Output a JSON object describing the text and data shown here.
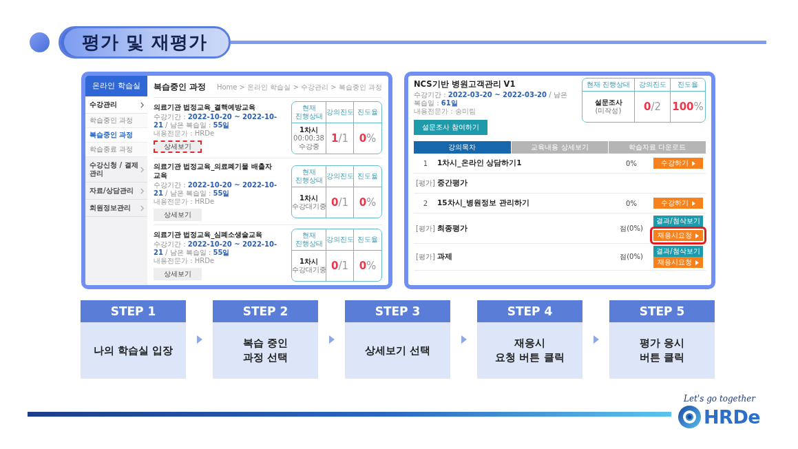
{
  "header": {
    "title": "평가 및 재평가"
  },
  "left_screen": {
    "sidebar": {
      "title": "온라인 학습실",
      "items": [
        {
          "label": "수강관리",
          "expanded": true,
          "children": [
            {
              "label": "학습중인 과정",
              "selected": false
            },
            {
              "label": "복습중인 과정",
              "selected": true
            },
            {
              "label": "학습종료 과정",
              "selected": false
            }
          ]
        },
        {
          "label": "수강신청 / 결제 관리",
          "expanded": false
        },
        {
          "label": "자료/상담관리",
          "expanded": false
        },
        {
          "label": "회원정보관리",
          "expanded": false
        }
      ]
    },
    "page_title": "복습중인 과정",
    "breadcrumb": "Home > 온라인 학습실 > 수강관리 > 복습중인 과정",
    "courses": [
      {
        "title": "의료기관 법정교육_결핵예방교육",
        "period": "수강기간 : **2022-10-20 ~ 2022-10-21** / 남은 복습일 : **55일**",
        "expert": "내용전문가 : HRDe",
        "button": {
          "label": "상세보기",
          "highlighted": true
        },
        "status_table": {
          "columns": [
            "현재 진행상태",
            "강의진도",
            "진도율"
          ],
          "status": [
            "1차시",
            "00:00:38",
            "수강중"
          ],
          "progress": "**1**/1",
          "rate": "**0**%"
        }
      },
      {
        "title": "의료기관 법정교육_의료폐기물 배출자 교육",
        "period": "수강기간 : **2022-10-20 ~ 2022-10-21** / 남은 복습일 : **55일**",
        "expert": "내용전문가 : HRDe",
        "button": {
          "label": "상세보기",
          "highlighted": false
        },
        "status_table": {
          "columns": [
            "현재 진행상태",
            "강의진도",
            "진도율"
          ],
          "status": [
            "1차시",
            "수강대기중"
          ],
          "progress": "**0**/1",
          "rate": "**0**%"
        }
      },
      {
        "title": "의료기관 법정교육_심폐소생술교육",
        "period": "수강기간 : **2022-10-20 ~ 2022-10-21** / 남은 복습일 : **55일**",
        "expert": "내용전문가 : HRDe",
        "button": {
          "label": "상세보기",
          "highlighted": false
        },
        "status_table": {
          "columns": [
            "현재 진행상태",
            "강의진도",
            "진도율"
          ],
          "status": [
            "1차시",
            "수강대기중"
          ],
          "progress": "**0**/1",
          "rate": "**0**%"
        }
      }
    ]
  },
  "right_screen": {
    "course_title": "NCS기반 병원고객관리 V1",
    "period": "수강기간 : **2022-03-20 ~ 2022-03-20** / 남은 복습일 : **61일**",
    "expert": "내용전문가 : 송미림",
    "survey_button": "설문조사 참여하기",
    "status_table": {
      "columns": [
        "현재 진행상태",
        "강의진도",
        "진도율"
      ],
      "status": [
        "설문조사",
        "(미작성)"
      ],
      "progress": "**0**/2",
      "rate": "**100**%"
    },
    "tabs": [
      {
        "label": "강의목차",
        "selected": true
      },
      {
        "label": "교육내용 상세보기",
        "selected": false
      },
      {
        "label": "학습자료 다운로드",
        "selected": false
      }
    ],
    "lessons": [
      {
        "kind": "lesson",
        "number": "1",
        "title": "1차시_온라인 상담하기1",
        "score": "0%",
        "buttons": [
          {
            "kind": "action",
            "label": "수강하기",
            "highlighted": false
          }
        ]
      },
      {
        "kind": "exam",
        "tag": "[평가]",
        "title": "중간평가"
      },
      {
        "kind": "lesson",
        "number": "2",
        "title": "15차시_병원정보 관리하기",
        "score": "0%",
        "buttons": [
          {
            "kind": "action",
            "label": "수강하기",
            "highlighted": false
          }
        ]
      },
      {
        "kind": "exam",
        "tag": "[평가]",
        "title": "최종평가",
        "score": "점(0%)",
        "buttons": [
          {
            "kind": "review",
            "label": "결과/첨삭보기",
            "highlighted": false
          },
          {
            "kind": "action",
            "label": "재응시요청",
            "highlighted": true
          }
        ]
      },
      {
        "kind": "exam",
        "tag": "[평가]",
        "title": "과제",
        "score": "점(0%)",
        "buttons": [
          {
            "kind": "review",
            "label": "결과/첨삭보기",
            "highlighted": false
          },
          {
            "kind": "action",
            "label": "재응시요청",
            "highlighted": false
          }
        ]
      }
    ]
  },
  "steps": [
    {
      "label": "STEP 1",
      "text": "나의 학습실 입장"
    },
    {
      "label": "STEP 2",
      "text": "복습 중인\n과정 선택"
    },
    {
      "label": "STEP 3",
      "text": "상세보기 선택"
    },
    {
      "label": "STEP 4",
      "text": "재응시\n요청 버튼 클릭"
    },
    {
      "label": "STEP 5",
      "text": "평가 응시\n버튼 클릭"
    }
  ],
  "footer": {
    "slogan": "Let's go together",
    "brand": "HRDe"
  }
}
